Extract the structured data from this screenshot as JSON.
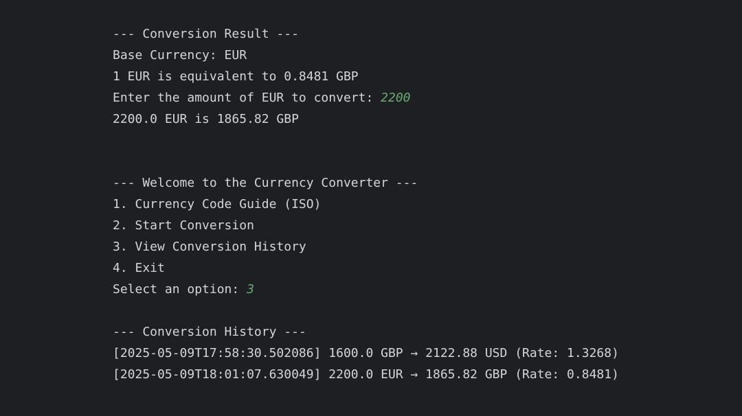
{
  "colors": {
    "background": "#1e1f22",
    "text": "#d4d6da",
    "user_input": "#6aab73"
  },
  "result": {
    "header": "--- Conversion Result ---",
    "base_currency": "Base Currency: EUR",
    "rate_line": "1 EUR is equivalent to 0.8481 GBP",
    "amount_prompt": "Enter the amount of EUR to convert: ",
    "amount_input": "2200",
    "result_line": "2200.0 EUR is 1865.82 GBP"
  },
  "menu": {
    "header": "--- Welcome to the Currency Converter ---",
    "options": [
      "1. Currency Code Guide (ISO)",
      "2. Start Conversion",
      "3. View Conversion History",
      "4. Exit"
    ],
    "select_prompt": "Select an option: ",
    "select_input": "3"
  },
  "history": {
    "header": "--- Conversion History ---",
    "entries": [
      "[2025-05-09T17:58:30.502086] 1600.0 GBP → 2122.88 USD (Rate: 1.3268)",
      "[2025-05-09T18:01:07.630049] 2200.0 EUR → 1865.82 GBP (Rate: 0.8481)"
    ]
  }
}
